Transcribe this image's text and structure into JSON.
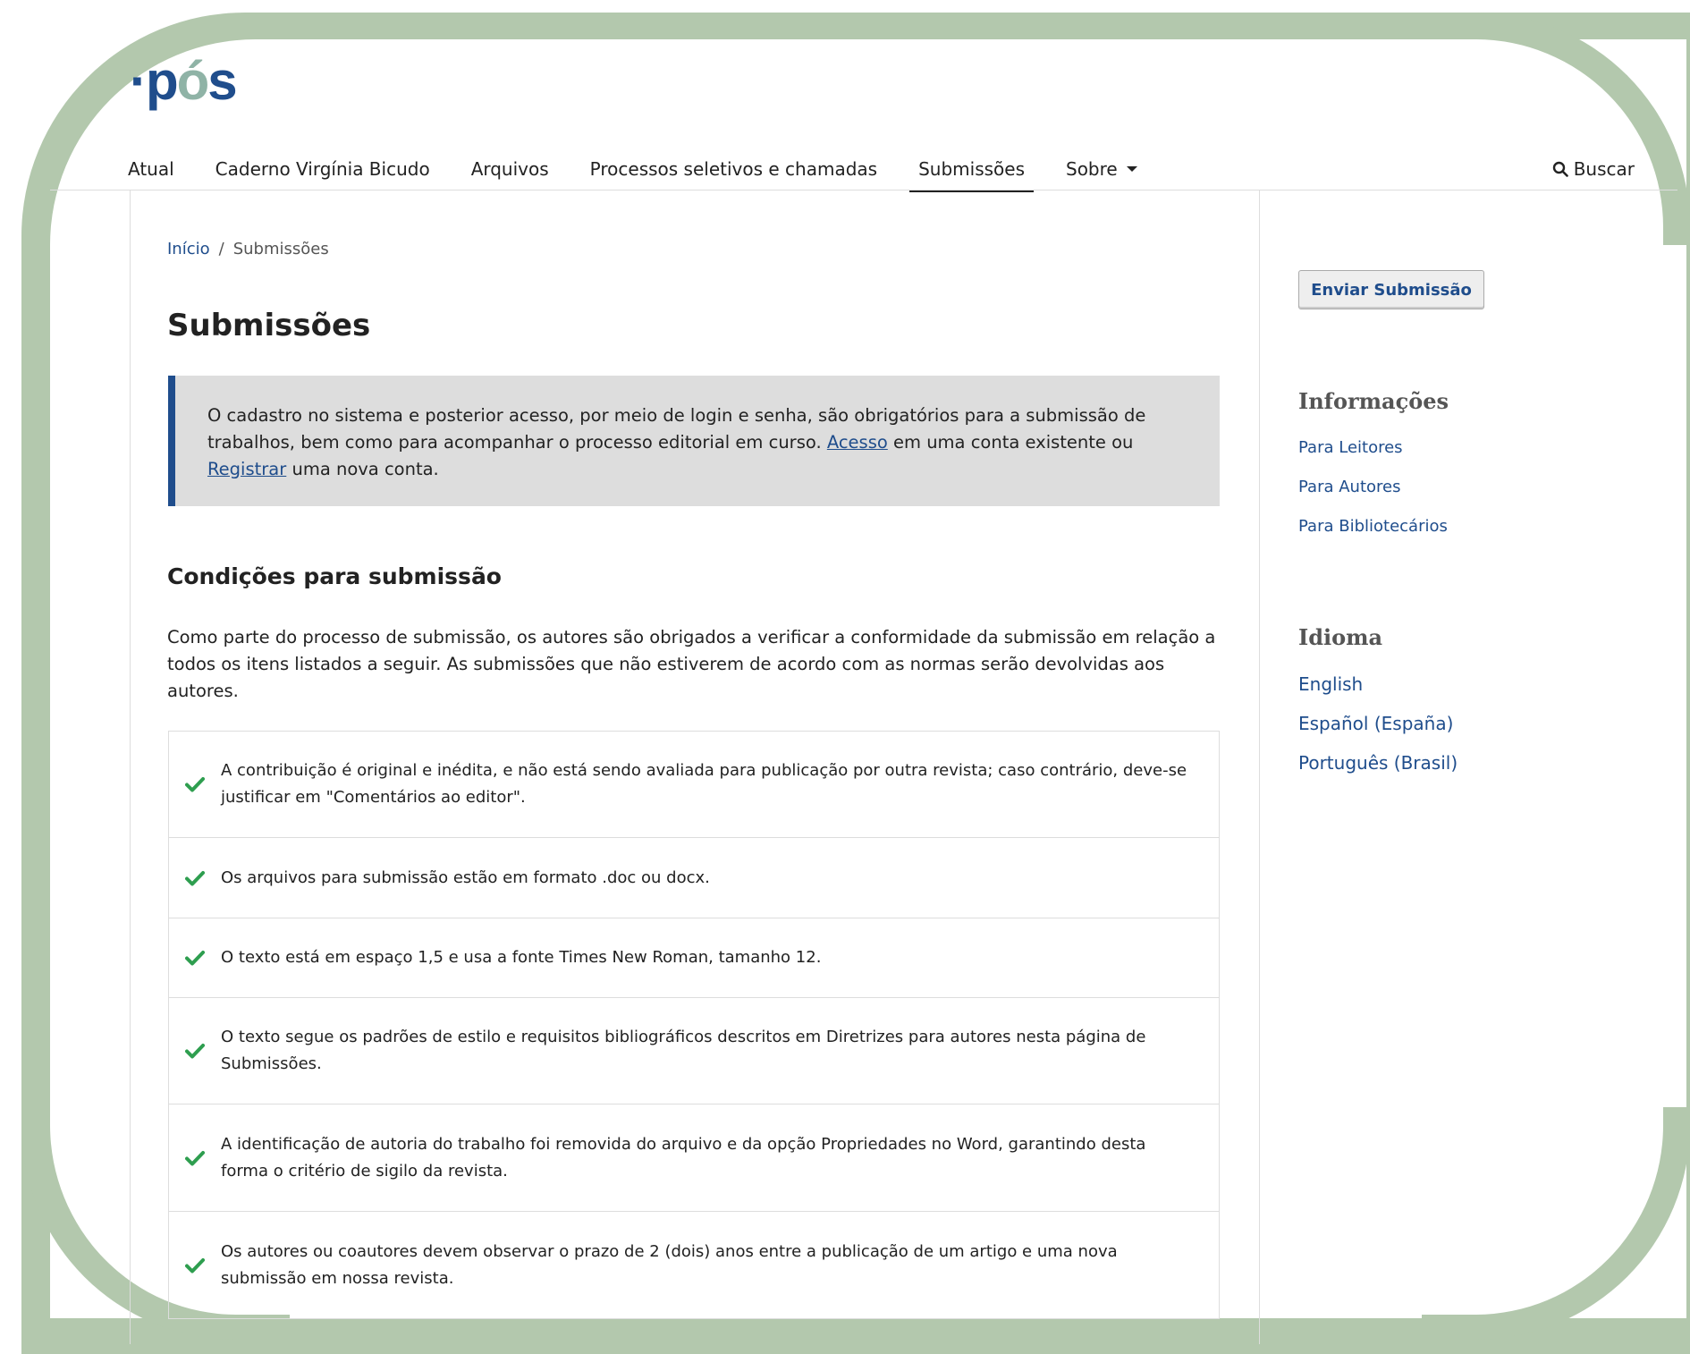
{
  "brand": {
    "logo_dot": "·",
    "logo_p": "p",
    "logo_o": "ó",
    "logo_s": "s"
  },
  "nav": {
    "items": [
      {
        "label": "Atual"
      },
      {
        "label": "Caderno Virgínia Bicudo"
      },
      {
        "label": "Arquivos"
      },
      {
        "label": "Processos seletivos e chamadas"
      },
      {
        "label": "Submissões",
        "active": true
      },
      {
        "label": "Sobre",
        "dropdown": true
      }
    ],
    "search_label": "Buscar"
  },
  "breadcrumb": {
    "home": "Início",
    "separator": "/",
    "current": "Submissões"
  },
  "page_title": "Submissões",
  "notice": {
    "text_before": "O cadastro no sistema e posterior acesso, por meio de login e senha, são obrigatórios para a submissão de trabalhos, bem como para acompanhar o processo editorial em curso. ",
    "login_link": "Acesso",
    "text_middle": " em uma conta existente ou ",
    "register_link": "Registrar",
    "text_after": " uma nova conta."
  },
  "conditions": {
    "title": "Condições para submissão",
    "intro": "Como parte do processo de submissão, os autores são obrigados a verificar a conformidade da submissão em relação a todos os itens listados a seguir. As submissões que não estiverem de acordo com as normas serão devolvidas aos autores.",
    "items": [
      "A contribuição é original e inédita, e não está sendo avaliada para publicação por outra revista; caso contrário, deve-se justificar em \"Comentários ao editor\".",
      "Os arquivos para submissão estão em formato .doc ou docx.",
      "O texto está em espaço 1,5 e usa a fonte Times New Roman, tamanho 12.",
      "O texto segue os padrões de estilo e requisitos bibliográficos descritos em Diretrizes para autores nesta página de Submissões.",
      "A identificação de autoria do trabalho foi removida do arquivo e da opção Propriedades no Word, garantindo desta forma o critério de sigilo da revista.",
      "Os autores ou coautores devem observar o prazo de 2 (dois) anos entre a publicação de um artigo e uma nova submissão em nossa revista."
    ]
  },
  "sidebar": {
    "submit_button": "Enviar Submissão",
    "info_title": "Informações",
    "info_links": [
      "Para Leitores",
      "Para Autores",
      "Para Bibliotecários"
    ],
    "language_title": "Idioma",
    "languages": [
      "English",
      "Español (España)",
      "Português (Brasil)"
    ]
  },
  "colors": {
    "frame": "#b3c8ad",
    "link": "#1f4d8c",
    "check": "#2e9e4f",
    "notice_bg": "#dddddd"
  }
}
